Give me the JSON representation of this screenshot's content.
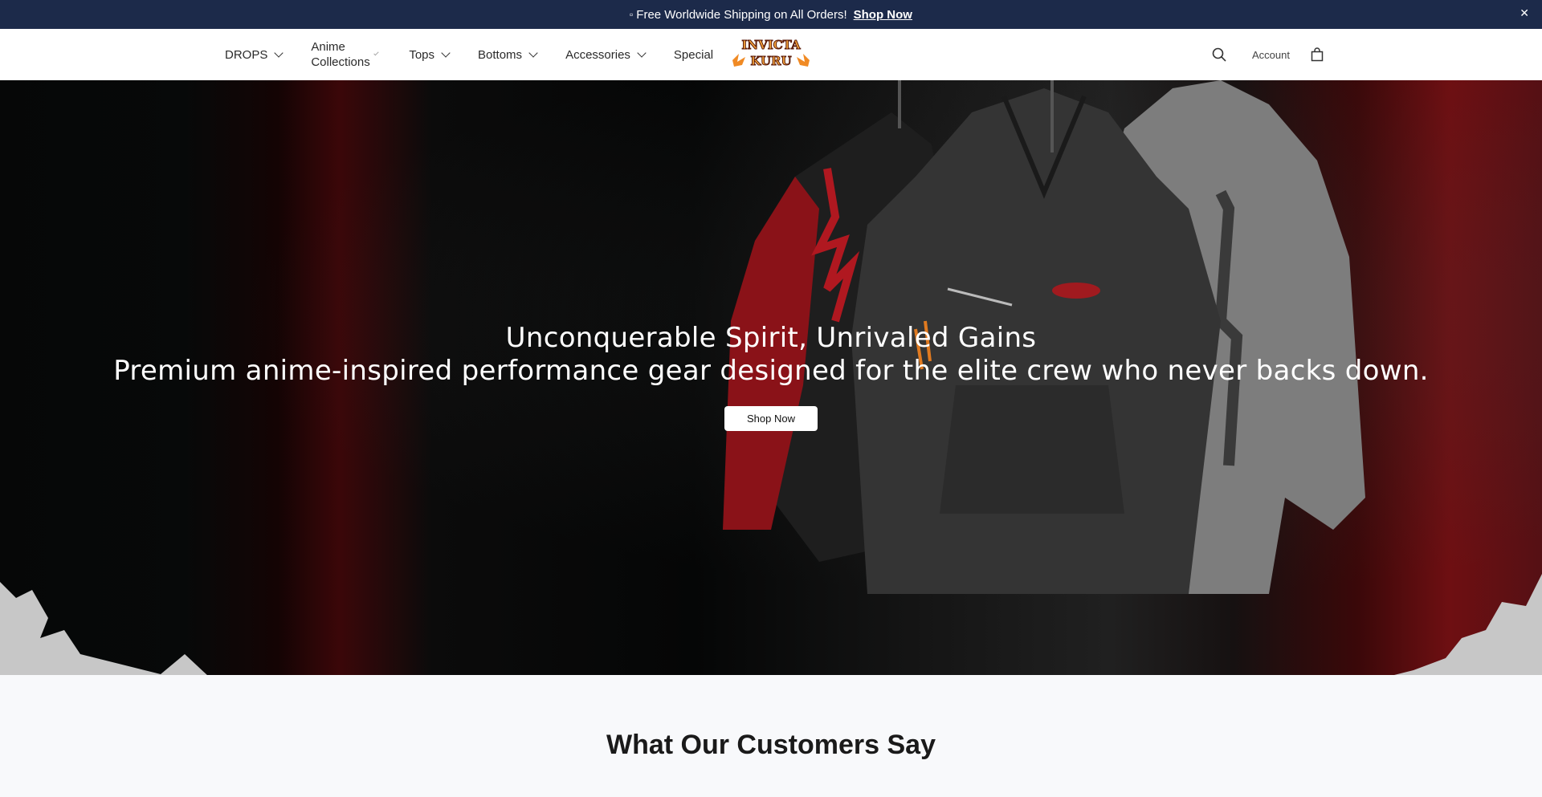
{
  "announcement": {
    "icon": "gift-icon",
    "text": "Free Worldwide Shipping on All Orders!",
    "link_label": "Shop Now",
    "close_label": "✕"
  },
  "nav": {
    "items": [
      {
        "label": "DROPS"
      },
      {
        "label": "Anime Collections"
      },
      {
        "label": "Tops"
      },
      {
        "label": "Bottoms"
      },
      {
        "label": "Accessories"
      },
      {
        "label": "Special"
      }
    ],
    "logo_text": [
      "INVICTA",
      "KURU"
    ],
    "account_label": "Account",
    "search_icon": "search-icon",
    "cart_icon": "shopping-bag-icon"
  },
  "hero": {
    "title": "Unconquerable Spirit, Unrivaled Gains",
    "subtitle": "Premium anime-inspired performance gear designed for the elite crew who never backs down.",
    "cta_label": "Shop Now"
  },
  "reviews": {
    "heading": "What Our Customers Say"
  },
  "colors": {
    "announcement_bg": "#1c2a4a",
    "accent_red": "#8c1016",
    "logo_orange": "#f08a24"
  }
}
